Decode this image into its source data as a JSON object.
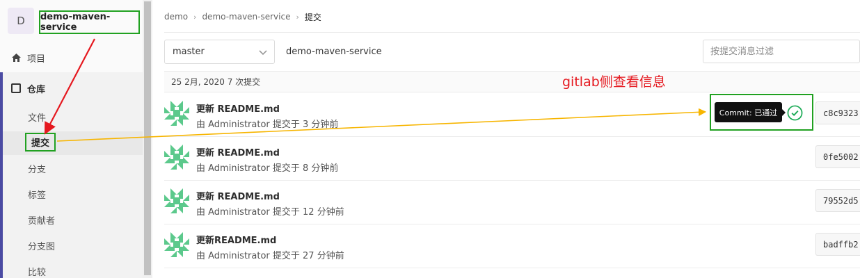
{
  "sidebar": {
    "avatar_letter": "D",
    "project_name": "demo-maven-service",
    "project_link": "项目",
    "repository": "仓库",
    "sub_items": [
      "文件",
      "提交",
      "分支",
      "标签",
      "贡献者",
      "分支图",
      "比较"
    ],
    "active_sub": "提交"
  },
  "breadcrumb": {
    "items": [
      "demo",
      "demo-maven-service",
      "提交"
    ]
  },
  "toolbar": {
    "branch": "master",
    "project_path": "demo-maven-service",
    "filter_placeholder": "按提交消息过滤"
  },
  "day_header": "25 2月, 2020 7 次提交",
  "commits": [
    {
      "title": "更新 README.md",
      "meta": "由 Administrator 提交于 3 分钟前",
      "sha": "c8c9323"
    },
    {
      "title": "更新 README.md",
      "meta": "由 Administrator 提交于 8 分钟前",
      "sha": "0fe5002"
    },
    {
      "title": "更新 README.md",
      "meta": "由 Administrator 提交于 12 分钟前",
      "sha": "79552d5"
    },
    {
      "title": "更新README.md",
      "meta": "由 Administrator 提交于 27 分钟前",
      "sha": "badffb2"
    }
  ],
  "pipeline_tooltip": "Commit: 已通过",
  "annotation": "gitlab侧查看信息",
  "colors": {
    "annotation_red": "#e5181f",
    "highlight_green": "#21a121",
    "arrow_orange": "#f7b500",
    "pass_green": "#1aaa55",
    "identicon_green": "#5cc98c"
  }
}
